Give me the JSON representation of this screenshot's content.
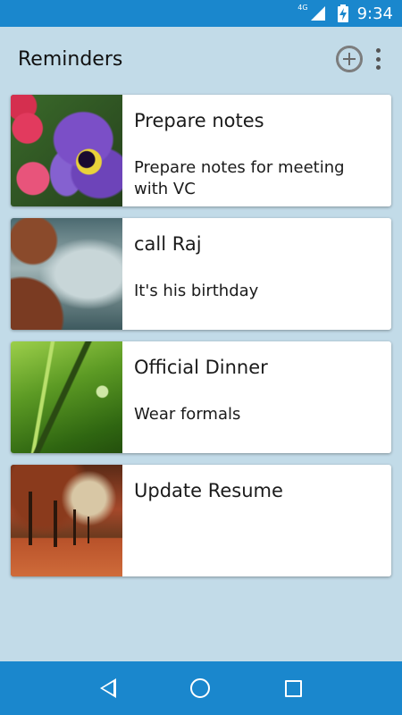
{
  "status_bar": {
    "network_label": "4G",
    "time": "9:34",
    "icons": [
      "signal-icon",
      "battery-charging-icon"
    ]
  },
  "app_bar": {
    "title": "Reminders",
    "actions": [
      "add-circle-icon",
      "overflow-menu-icon"
    ]
  },
  "reminders": [
    {
      "title": "Prepare notes",
      "description": "Prepare notes for meeting with VC",
      "image": "purple-pansy-flower"
    },
    {
      "title": "call Raj",
      "description": "It's his birthday",
      "image": "misty-sea-rocks"
    },
    {
      "title": "Official Dinner",
      "description": "Wear formals",
      "image": "ant-on-grass-blade"
    },
    {
      "title": "Update Resume",
      "description": "",
      "image": "autumn-tree-avenue"
    }
  ],
  "nav_bar": {
    "buttons": [
      "back-icon",
      "home-icon",
      "recents-icon"
    ]
  },
  "colors": {
    "primary": "#1a87cd",
    "background": "#c2dbe8",
    "card": "#ffffff"
  }
}
